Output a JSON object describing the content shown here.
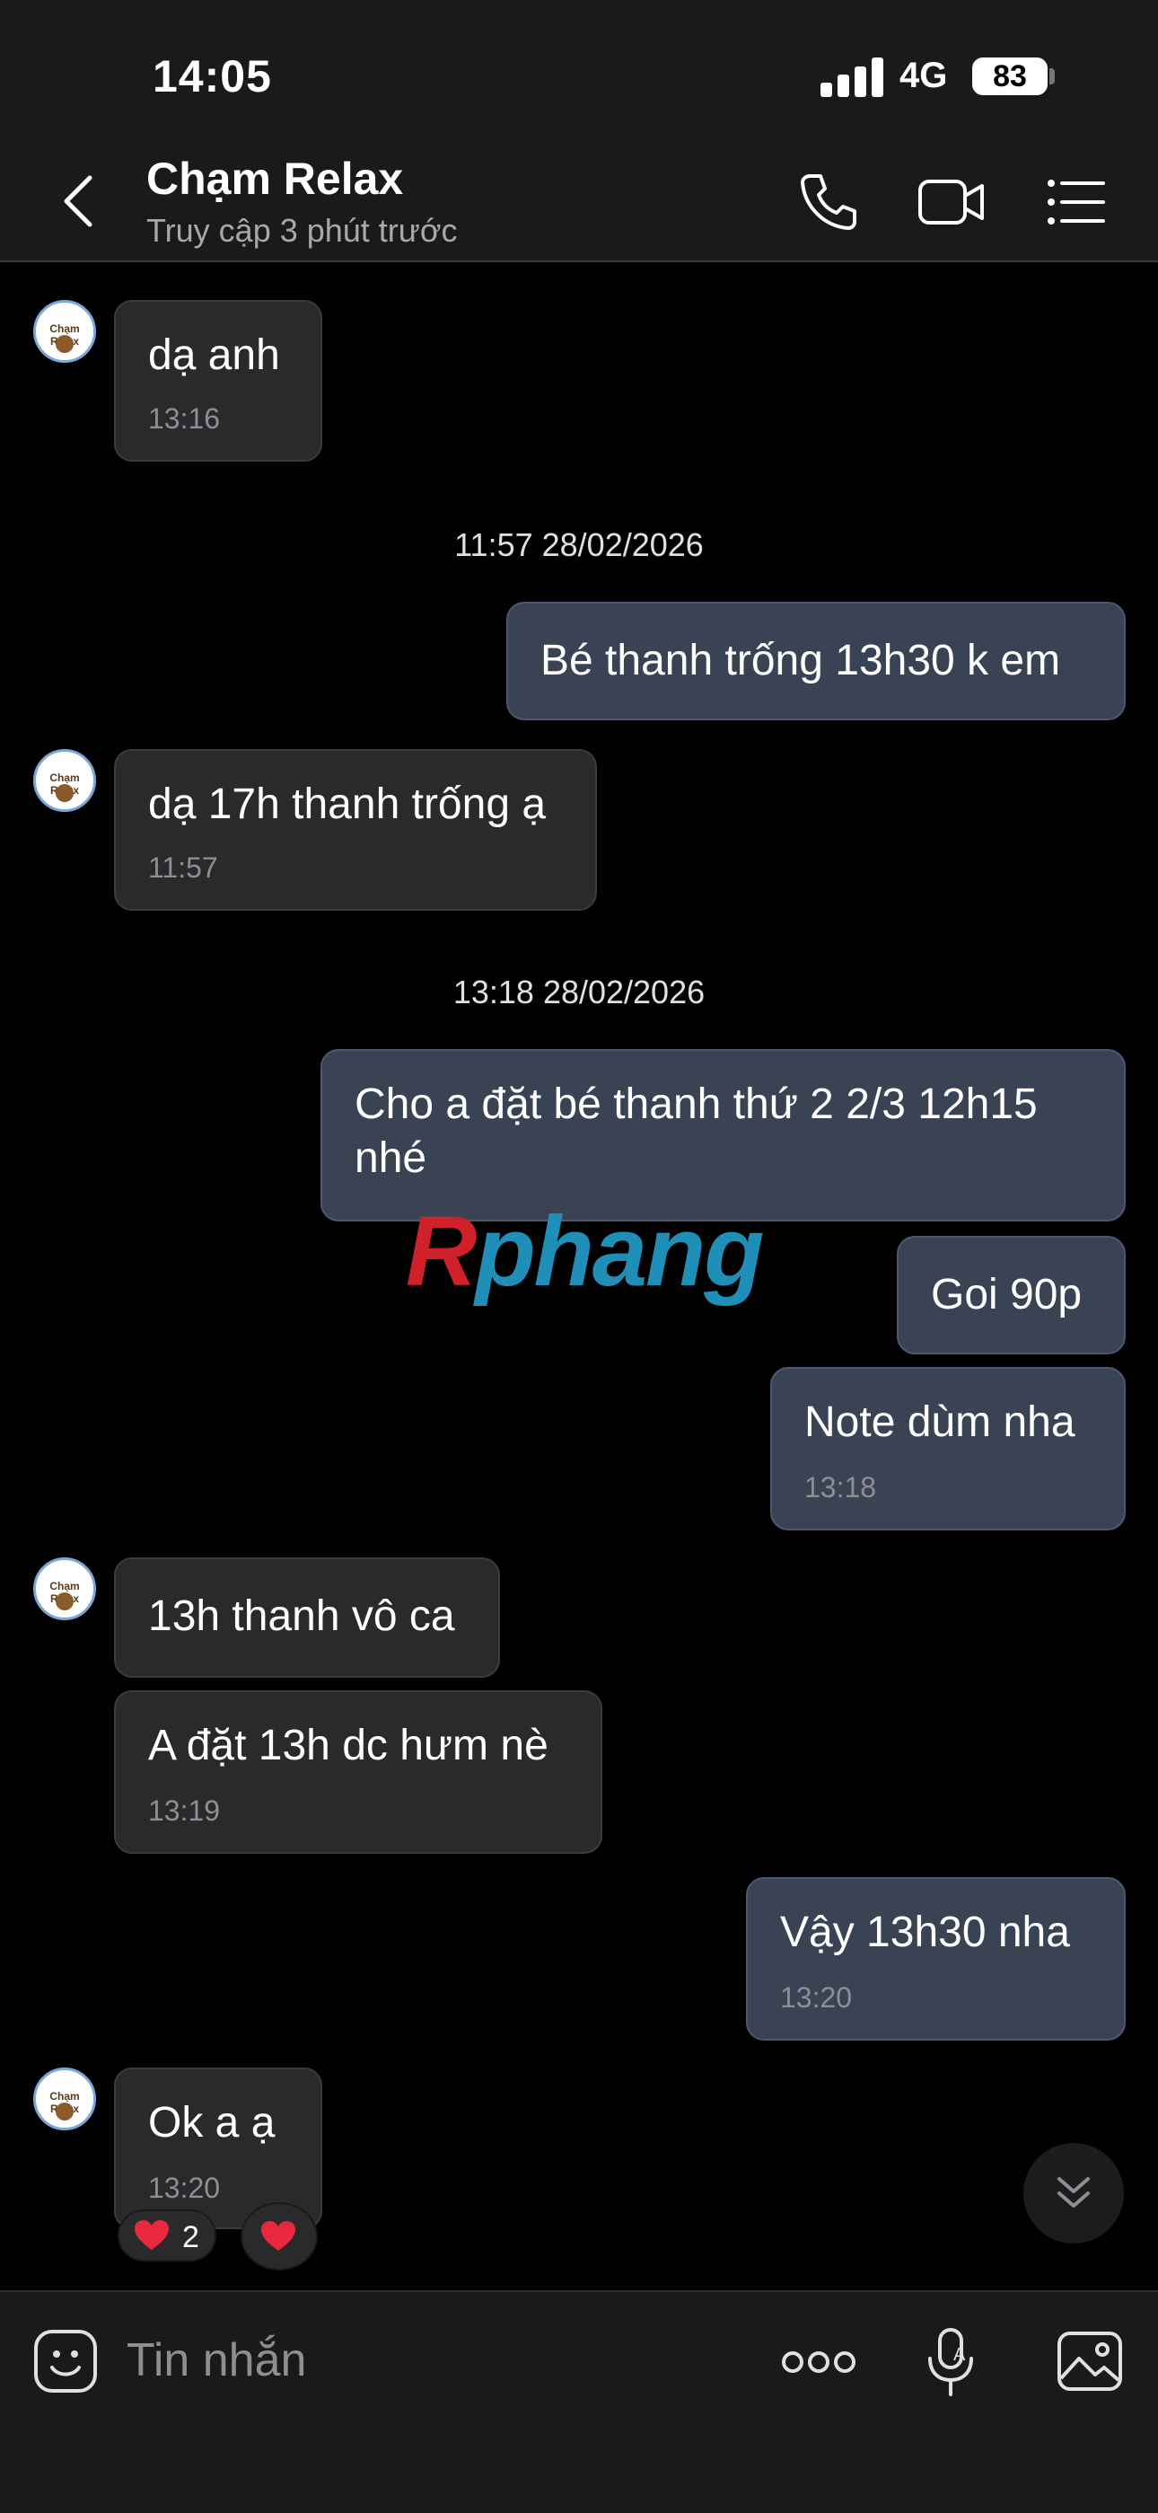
{
  "status_bar": {
    "time": "14:05",
    "network": "4G",
    "battery": "83"
  },
  "header": {
    "contact_name": "Chạm Relax",
    "contact_status": "Truy cập 3 phút trước"
  },
  "avatar_label": "Chạm Relax",
  "messages": [
    {
      "side": "in",
      "text": "dạ anh",
      "time": "13:16"
    },
    {
      "type": "date",
      "text": "11:57 28/02/2026"
    },
    {
      "side": "out",
      "text": "Bé thanh trống 13h30 k em",
      "time": ""
    },
    {
      "side": "in",
      "text": "dạ 17h thanh trống ạ",
      "time": "11:57"
    },
    {
      "type": "date",
      "text": "13:18 28/02/2026"
    },
    {
      "side": "out",
      "text_line1": "Cho a đặt bé thanh thứ 2 2/3  12h15",
      "text_line2": "nhé",
      "time": ""
    },
    {
      "side": "out",
      "text": "Goi 90p",
      "time": ""
    },
    {
      "side": "out",
      "text": "Note dùm nha",
      "time": "13:18"
    },
    {
      "side": "in",
      "text": "13h thanh vô ca",
      "time": ""
    },
    {
      "side": "in",
      "text": "A đặt 13h dc hưm nè",
      "time": "13:19"
    },
    {
      "side": "out",
      "text": "Vậy 13h30  nha",
      "time": "13:20"
    },
    {
      "side": "in",
      "text": "Ok a ạ",
      "time": "13:20"
    }
  ],
  "reactions": {
    "count": "2"
  },
  "watermark": {
    "part1": "R",
    "part2": "phang",
    "color1": "#d0202a",
    "color2": "#1f8fb8"
  },
  "composer": {
    "placeholder": "Tin nhắn"
  },
  "colors": {
    "incoming_bubble": "#2a2a2c",
    "outgoing_bubble": "#3a4354",
    "background": "#000000",
    "bar": "#1a1a1a"
  }
}
